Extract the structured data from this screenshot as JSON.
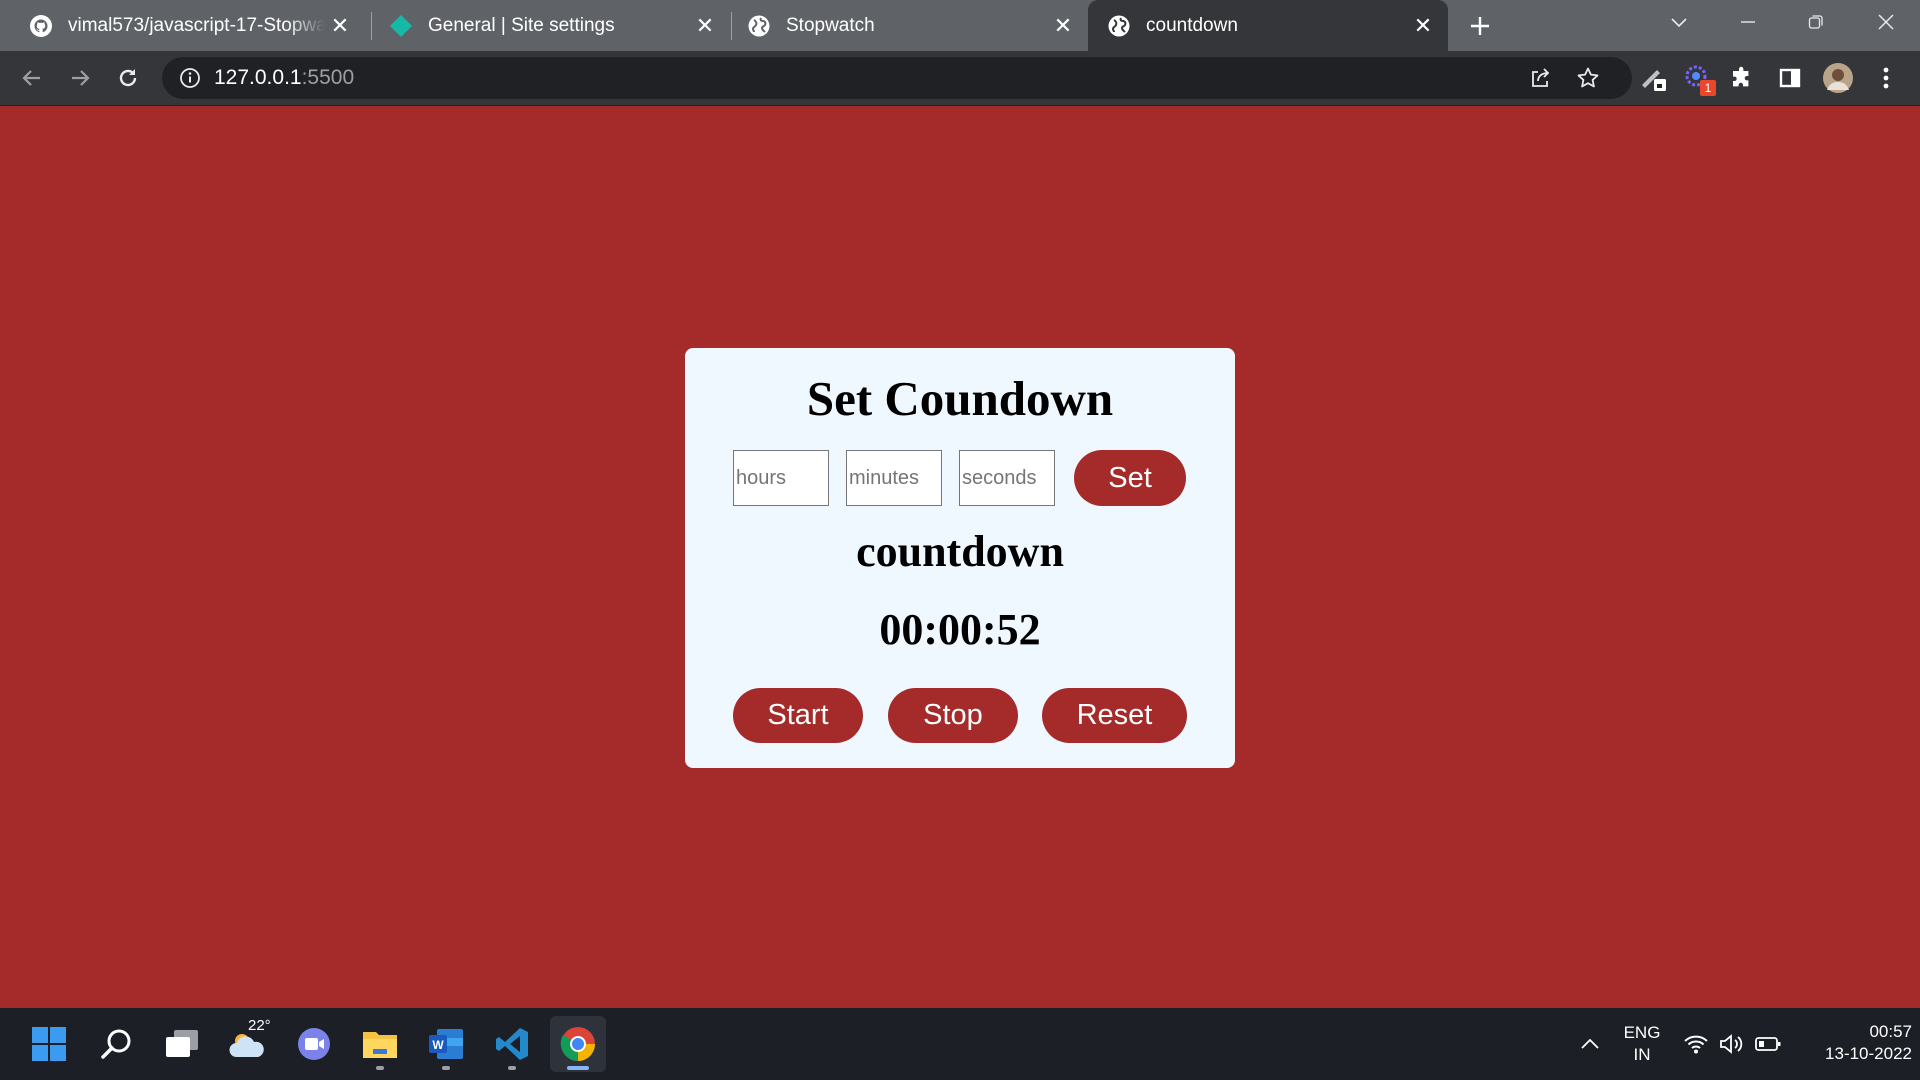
{
  "browser": {
    "tabs": [
      {
        "title": "vimal573/javascript-17-Stopwatch",
        "icon": "github-icon",
        "active": false
      },
      {
        "title": "General | Site settings",
        "icon": "diamond-icon",
        "active": false
      },
      {
        "title": "Stopwatch",
        "icon": "globe-icon",
        "active": false
      },
      {
        "title": "countdown",
        "icon": "globe-icon",
        "active": true
      }
    ],
    "address": {
      "host": "127.0.0.1",
      "port": ":5500"
    },
    "extension_badge": "1"
  },
  "page": {
    "heading": "Set Coundown",
    "inputs": {
      "hours_placeholder": "hours",
      "minutes_placeholder": "minutes",
      "seconds_placeholder": "seconds"
    },
    "set_label": "Set",
    "label": "countdown",
    "time": "00:00:52",
    "start_label": "Start",
    "stop_label": "Stop",
    "reset_label": "Reset"
  },
  "taskbar": {
    "weather_temp": "22°",
    "language_line1": "ENG",
    "language_line2": "IN",
    "clock_time": "00:57",
    "clock_date": "13-10-2022"
  },
  "colors": {
    "page_background": "#a52a2a",
    "card_background": "#f0f8ff",
    "button_background": "#a52a2a",
    "tabstrip": "#5f6368",
    "toolbar": "#35363a"
  }
}
